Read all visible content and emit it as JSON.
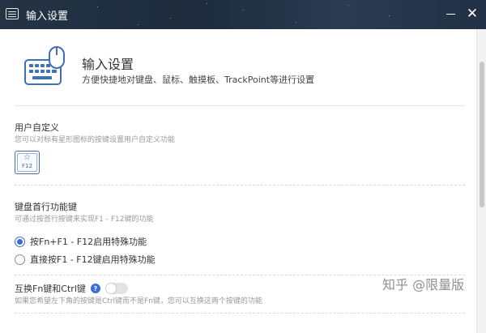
{
  "window": {
    "title": "输入设置"
  },
  "header": {
    "title": "输入设置",
    "description": "方便快捷地对键盘、鼠标、触摸板、TrackPoint等进行设置",
    "icon": "keyboard-mouse-icon"
  },
  "custom_section": {
    "title": "用户自定义",
    "description": "您可以对标有星形图标的按键设置用户自定义功能",
    "key_label": "F12",
    "key_icon": "star-icon"
  },
  "fn_section": {
    "title": "键盘首行功能键",
    "description": "可通过按首行按键来实现F1 - F12键的功能",
    "options": [
      {
        "label": "按Fn+F1 - F12启用特殊功能",
        "checked": true
      },
      {
        "label": "直接按F1 - F12键启用特殊功能",
        "checked": false
      }
    ]
  },
  "swap_section": {
    "title": "互换Fn键和Ctrl键",
    "help": "?",
    "toggle_on": false,
    "description": "如果您希望左下角的按键是Ctrl键而不是Fn键，您可以互换这两个按键的功能"
  },
  "watermark": "知乎 @限量版",
  "colors": {
    "accent": "#3a6ed6",
    "titlebar": "#1d2b3b"
  }
}
